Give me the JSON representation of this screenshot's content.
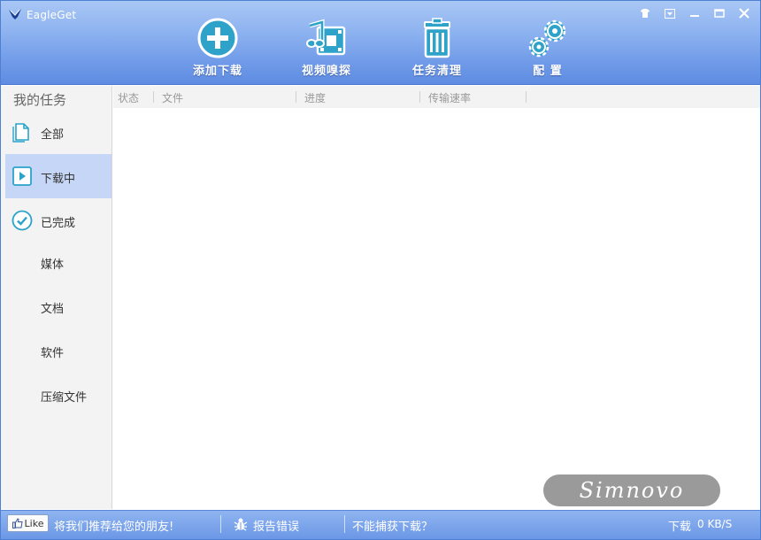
{
  "app": {
    "title": "EagleGet"
  },
  "toolbar": {
    "add_download": "添加下载",
    "video_sniffer": "视频嗅探",
    "task_cleanup": "任务清理",
    "settings": "配 置"
  },
  "sidebar": {
    "title": "我的任务",
    "items": [
      {
        "label": "全部",
        "icon": "document-icon"
      },
      {
        "label": "下载中",
        "icon": "play-icon",
        "active": true
      },
      {
        "label": "已完成",
        "icon": "check-circle-icon"
      },
      {
        "label": "媒体"
      },
      {
        "label": "文档"
      },
      {
        "label": "软件"
      },
      {
        "label": "压缩文件"
      }
    ]
  },
  "list": {
    "columns": [
      "状态",
      "文件",
      "进度",
      "传输速率"
    ]
  },
  "watermark": "Simnovo",
  "statusbar": {
    "like": "Like",
    "recommend": "将我们推荐给您的朋友!",
    "report_bug": "报告错误",
    "cannot_capture": "不能捕获下载？",
    "download_label": "下载",
    "download_speed": "0 KB/S"
  },
  "colors": {
    "header_blue": "#6f9ae8",
    "accent_teal": "#2ba3c9",
    "active_item": "#c6d6f6"
  }
}
